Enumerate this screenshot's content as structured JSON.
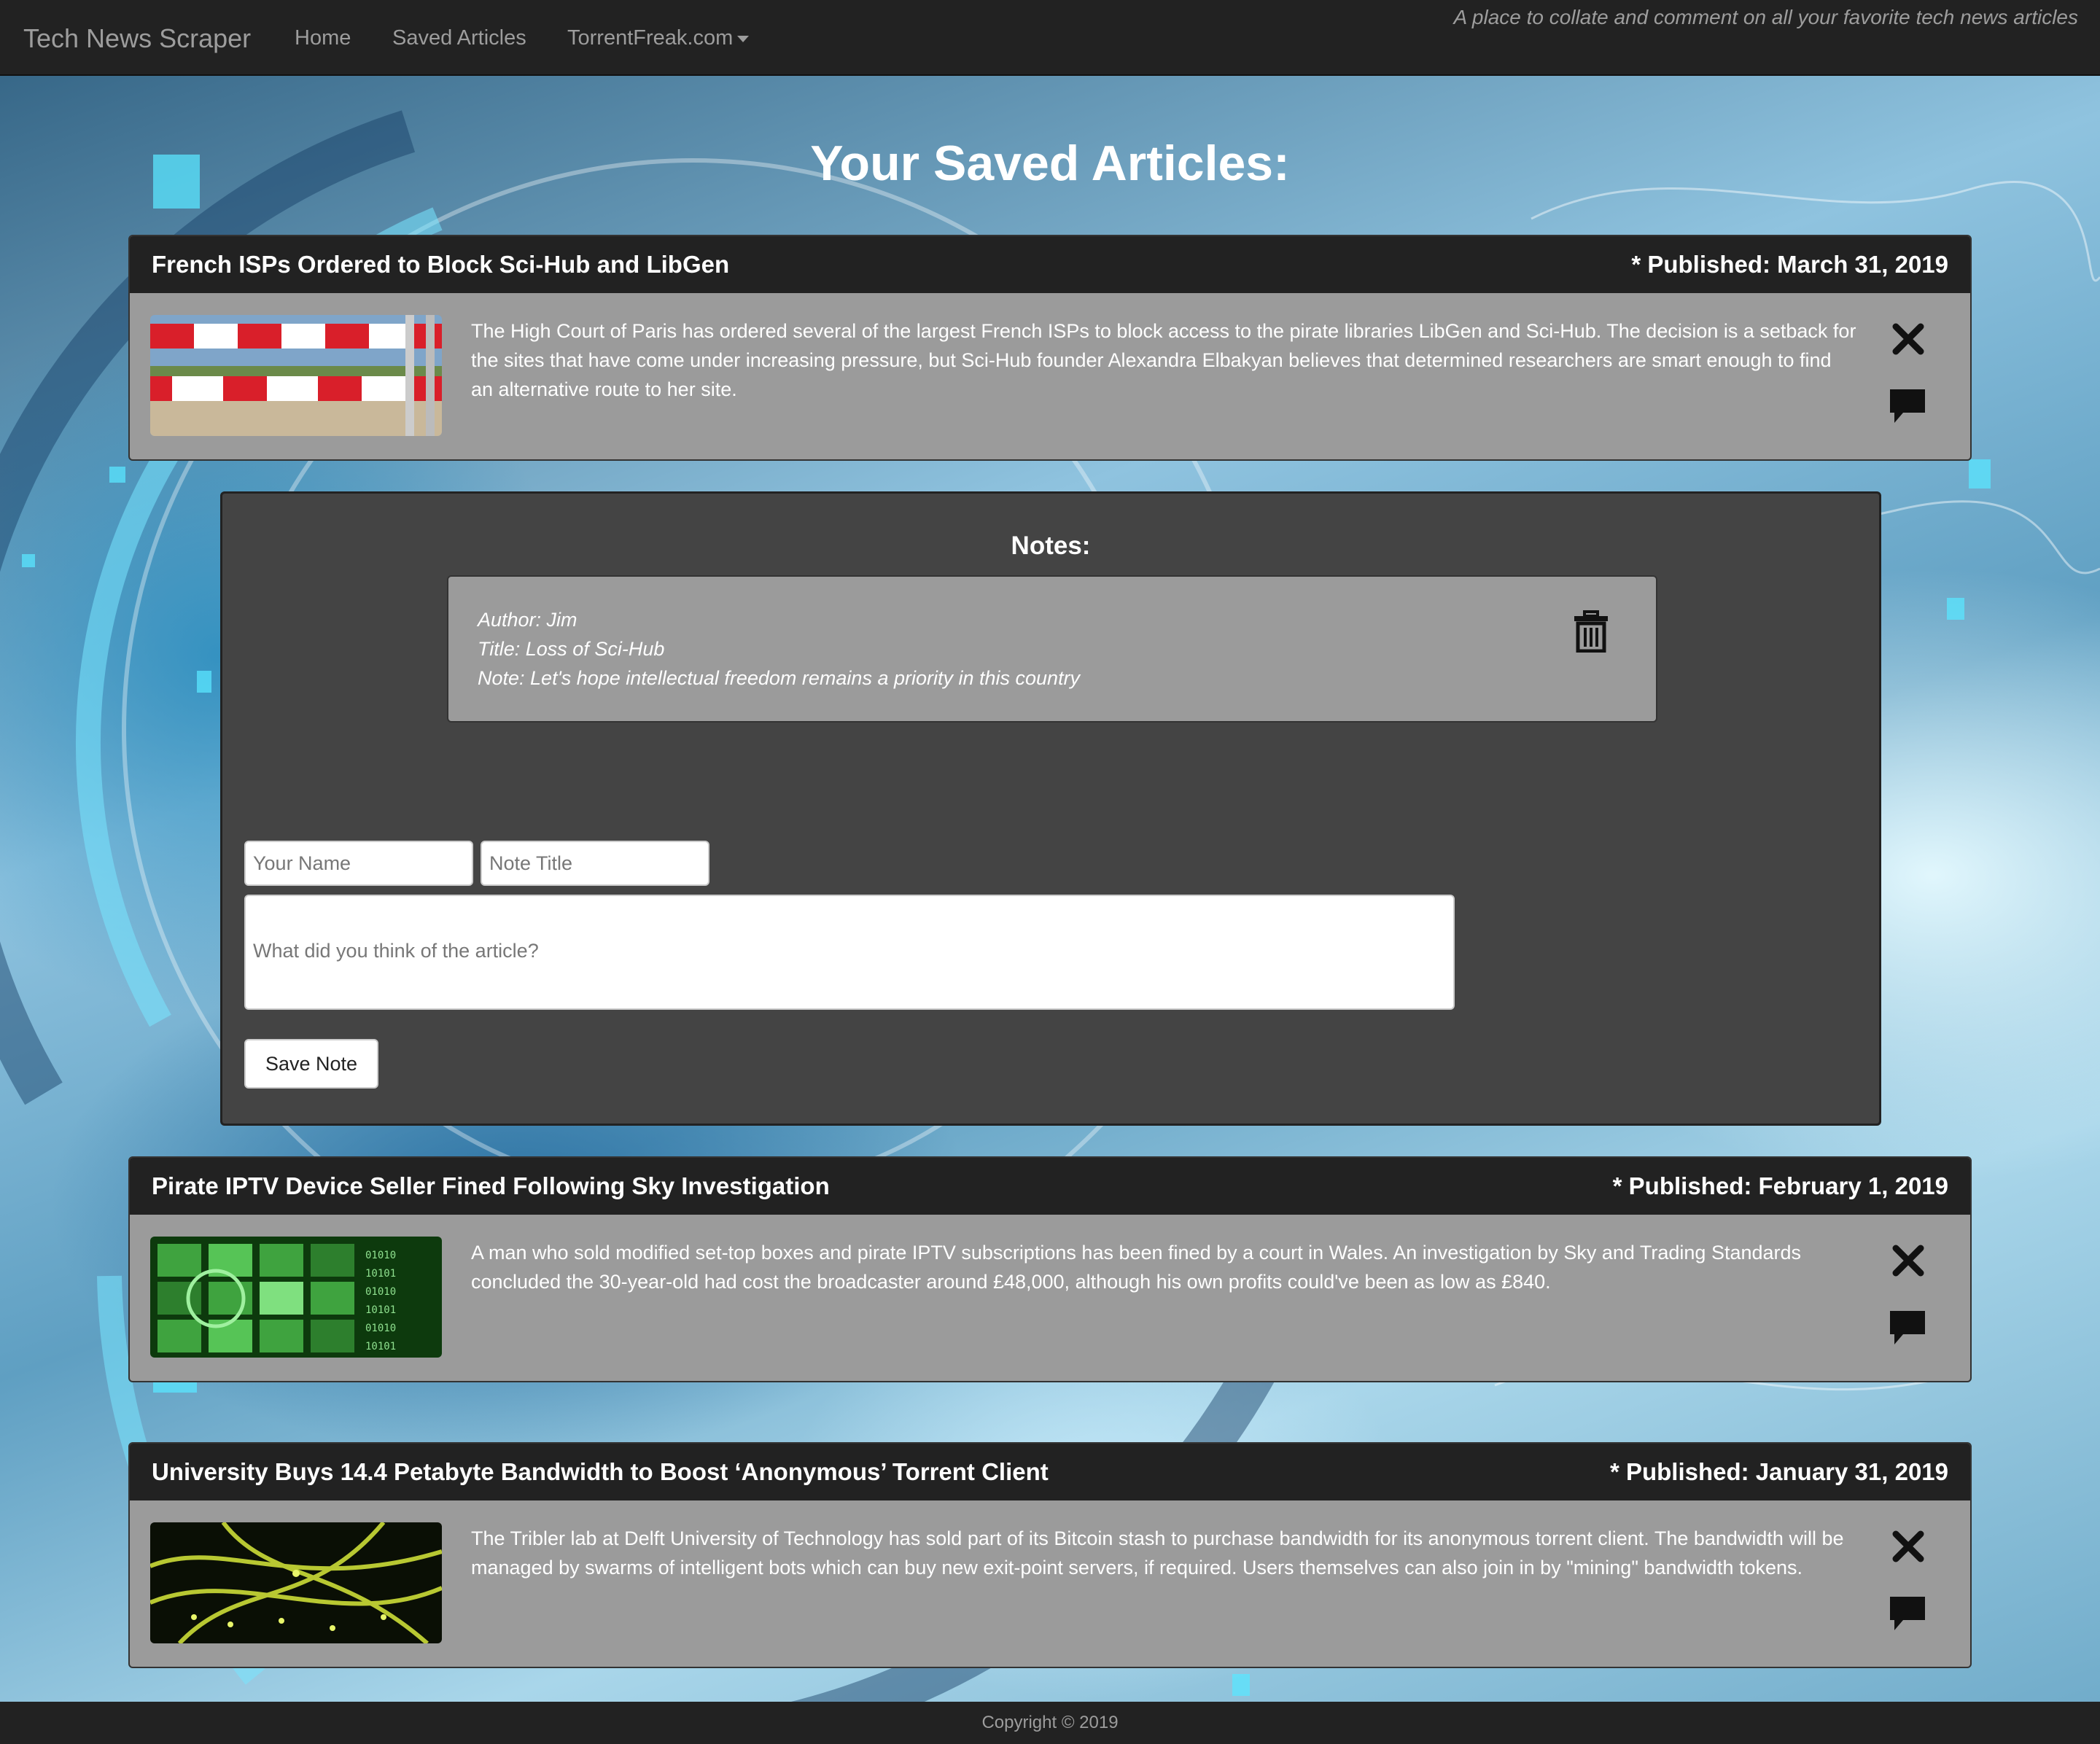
{
  "navbar": {
    "brand": "Tech News Scraper",
    "links": [
      "Home",
      "Saved Articles",
      "TorrentFreak.com"
    ],
    "tagline": "A place to collate and comment on all your favorite tech news articles"
  },
  "page_title": "Your Saved Articles:",
  "articles": [
    {
      "title": "French ISPs Ordered to Block Sci-Hub and LibGen",
      "published": "* Published: March 31, 2019",
      "summary": "The High Court of Paris has ordered several of the largest French ISPs to block access to the pirate libraries LibGen and Sci-Hub. The decision is a setback for the sites that have come under increasing pressure, but Sci-Hub founder Alexandra Elbakyan believes that determined researchers are smart enough to find an alternative route to her site."
    },
    {
      "title": "Pirate IPTV Device Seller Fined Following Sky Investigation",
      "published": "* Published: February 1, 2019",
      "summary": "A man who sold modified set-top boxes and pirate IPTV subscriptions has been fined by a court in Wales. An investigation by Sky and Trading Standards concluded the 30-year-old had cost the broadcaster around £48,000, although his own profits could've been as low as £840."
    },
    {
      "title": "University Buys 14.4 Petabyte Bandwidth to Boost ‘Anonymous’ Torrent Client",
      "published": "* Published: January 31, 2019",
      "summary": "The Tribler lab at Delft University of Technology has sold part of its Bitcoin stash to purchase bandwidth for its anonymous torrent client. The bandwidth will be managed by swarms of intelligent bots which can buy new exit-point servers, if required. Users themselves can also join in by \"mining\" bandwidth tokens."
    }
  ],
  "notes": {
    "heading": "Notes:",
    "items": [
      {
        "author": "Author: Jim",
        "title": "Title: Loss of Sci-Hub",
        "note": "Note: Let's hope intellectual freedom remains a priority in this country"
      }
    ],
    "form": {
      "name_placeholder": "Your Name",
      "title_placeholder": "Note Title",
      "body_placeholder": "What did you think of the article?",
      "save_label": "Save Note"
    }
  },
  "footer": {
    "copyright": "Copyright © 2019"
  },
  "icons": {
    "delete": "close-icon",
    "comment": "comment-icon",
    "trash": "trash-icon"
  },
  "colors": {
    "navbar": "#222222",
    "panel": "#9b9b9b",
    "notes_bg": "#444444",
    "text_light": "#9d9d9d"
  }
}
